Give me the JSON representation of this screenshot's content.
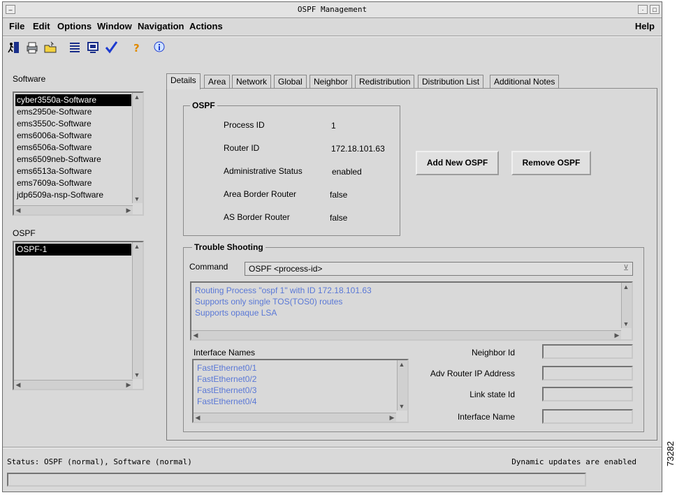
{
  "window": {
    "title": "OSPF Management"
  },
  "menubar": {
    "items": [
      {
        "label": "File"
      },
      {
        "label": "Edit"
      },
      {
        "label": "Options"
      },
      {
        "label": "Window"
      },
      {
        "label": "Navigation"
      },
      {
        "label": "Actions"
      }
    ],
    "help": "Help"
  },
  "toolbar": {
    "buttons": [
      {
        "icon": "exit-icon"
      },
      {
        "icon": "print-icon"
      },
      {
        "icon": "open-folder-icon"
      },
      {
        "icon": "list-icon"
      },
      {
        "icon": "monitor-icon"
      },
      {
        "icon": "checkmark-icon"
      },
      {
        "icon": "help-icon"
      },
      {
        "icon": "info-icon"
      }
    ]
  },
  "software": {
    "label": "Software",
    "items": [
      "cyber3550a-Software",
      "ems2950e-Software",
      "ems3550c-Software",
      "ems6006a-Software",
      "ems6506a-Software",
      "ems6509neb-Software",
      "ems6513a-Software",
      "ems7609a-Software",
      "jdp6509a-nsp-Software"
    ],
    "selected_index": 0
  },
  "ospf_list": {
    "label": "OSPF",
    "items": [
      "OSPF-1"
    ],
    "selected_index": 0
  },
  "tabs": [
    {
      "label": "Details",
      "active": true
    },
    {
      "label": "Area"
    },
    {
      "label": "Network"
    },
    {
      "label": "Global"
    },
    {
      "label": "Neighbor"
    },
    {
      "label": "Redistribution"
    },
    {
      "label": "Distribution List"
    },
    {
      "label": "Additional Notes"
    }
  ],
  "ospf_group": {
    "title": "OSPF",
    "rows": [
      {
        "label": "Process ID",
        "value": "1"
      },
      {
        "label": "Router ID",
        "value": "172.18.101.63"
      },
      {
        "label": "Administrative Status",
        "value": "enabled"
      },
      {
        "label": "Area Border Router",
        "value": "false"
      },
      {
        "label": "AS Border Router",
        "value": "false"
      }
    ]
  },
  "buttons": {
    "add": "Add New OSPF",
    "remove": "Remove OSPF"
  },
  "trouble": {
    "title": "Trouble Shooting",
    "command_label": "Command",
    "command_value": "OSPF <process-id>",
    "output": [
      "Routing Process \"ospf 1\" with ID 172.18.101.63",
      "Supports only single TOS(TOS0) routes",
      "Supports opaque LSA"
    ],
    "interface_names_label": "Interface Names",
    "interfaces": [
      "FastEthernet0/1",
      "FastEthernet0/2",
      "FastEthernet0/3",
      "FastEthernet0/4"
    ],
    "fields": [
      {
        "label": "Neighbor Id",
        "value": ""
      },
      {
        "label": "Adv Router IP Address",
        "value": ""
      },
      {
        "label": "Link state Id",
        "value": ""
      },
      {
        "label": "Interface Name",
        "value": ""
      }
    ]
  },
  "status": {
    "left": "Status: OSPF (normal), Software (normal)",
    "right": "Dynamic updates are enabled",
    "bar_text": ""
  },
  "figure_id": "73282",
  "colors": {
    "selection": "#000000",
    "output_text": "#5a78d6",
    "window_bg": "#d9d9d9"
  }
}
